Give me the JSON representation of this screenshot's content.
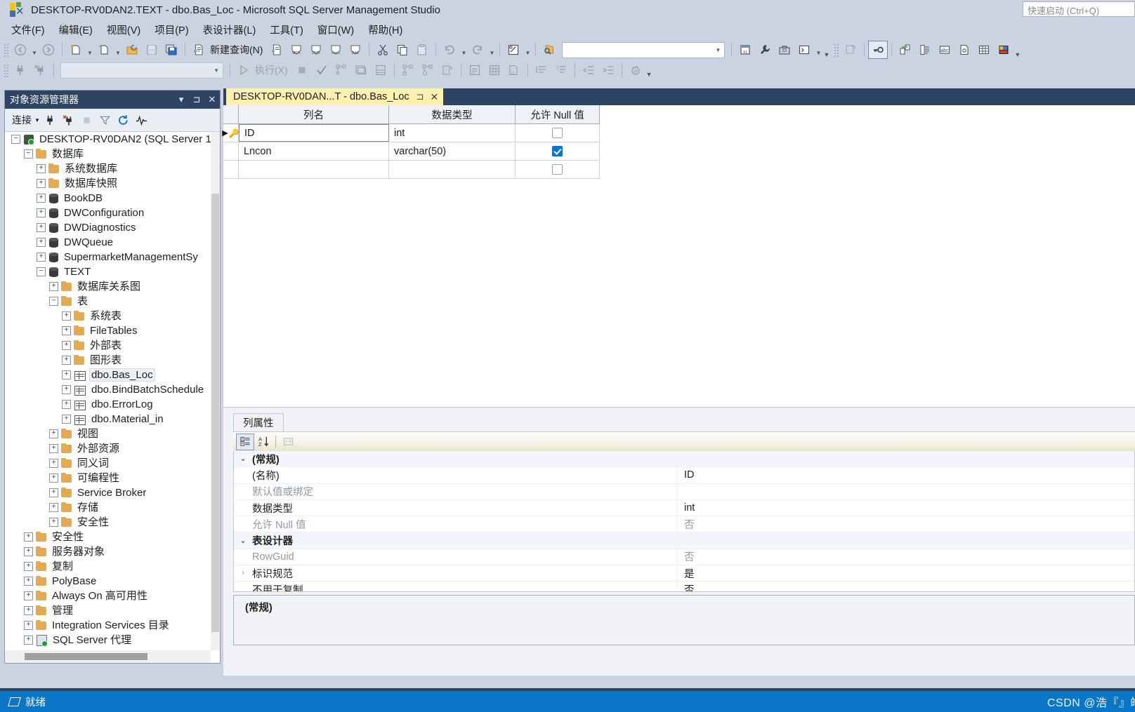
{
  "window": {
    "title": "DESKTOP-RV0DAN2.TEXT - dbo.Bas_Loc - Microsoft SQL Server Management Studio",
    "quick_launch": "快速启动 (Ctrl+Q)"
  },
  "menubar": [
    {
      "label": "文件(F)"
    },
    {
      "label": "编辑(E)"
    },
    {
      "label": "视图(V)"
    },
    {
      "label": "项目(P)"
    },
    {
      "label": "表设计器(L)"
    },
    {
      "label": "工具(T)"
    },
    {
      "label": "窗口(W)"
    },
    {
      "label": "帮助(H)"
    }
  ],
  "toolbar": {
    "new_query_label": "新建查询(N)",
    "execute_label": "执行(X)",
    "db_combo_value": "",
    "filter_combo_value": ""
  },
  "object_explorer": {
    "title": "对象资源管理器",
    "connect_label": "连接",
    "tree": [
      {
        "label": "DESKTOP-RV0DAN2 (SQL Server 1",
        "depth": 0,
        "icon": "server-icon",
        "state": "expanded"
      },
      {
        "label": "数据库",
        "depth": 1,
        "icon": "folder-icon",
        "state": "expanded"
      },
      {
        "label": "系统数据库",
        "depth": 2,
        "icon": "folder-icon",
        "state": "collapsed"
      },
      {
        "label": "数据库快照",
        "depth": 2,
        "icon": "folder-icon",
        "state": "collapsed"
      },
      {
        "label": "BookDB",
        "depth": 2,
        "icon": "database-icon",
        "state": "collapsed"
      },
      {
        "label": "DWConfiguration",
        "depth": 2,
        "icon": "database-icon",
        "state": "collapsed"
      },
      {
        "label": "DWDiagnostics",
        "depth": 2,
        "icon": "database-icon",
        "state": "collapsed"
      },
      {
        "label": "DWQueue",
        "depth": 2,
        "icon": "database-icon",
        "state": "collapsed"
      },
      {
        "label": "SupermarketManagementSy",
        "depth": 2,
        "icon": "database-icon",
        "state": "collapsed"
      },
      {
        "label": "TEXT",
        "depth": 2,
        "icon": "database-icon",
        "state": "expanded"
      },
      {
        "label": "数据库关系图",
        "depth": 3,
        "icon": "folder-icon",
        "state": "collapsed"
      },
      {
        "label": "表",
        "depth": 3,
        "icon": "folder-icon",
        "state": "expanded"
      },
      {
        "label": "系统表",
        "depth": 4,
        "icon": "folder-icon",
        "state": "collapsed"
      },
      {
        "label": "FileTables",
        "depth": 4,
        "icon": "folder-icon",
        "state": "collapsed"
      },
      {
        "label": "外部表",
        "depth": 4,
        "icon": "folder-icon",
        "state": "collapsed"
      },
      {
        "label": "图形表",
        "depth": 4,
        "icon": "folder-icon",
        "state": "collapsed"
      },
      {
        "label": "dbo.Bas_Loc",
        "depth": 4,
        "icon": "table-icon",
        "state": "collapsed",
        "selected": true
      },
      {
        "label": "dbo.BindBatchSchedule",
        "depth": 4,
        "icon": "table-icon",
        "state": "collapsed"
      },
      {
        "label": "dbo.ErrorLog",
        "depth": 4,
        "icon": "table-icon",
        "state": "collapsed"
      },
      {
        "label": "dbo.Material_in",
        "depth": 4,
        "icon": "table-icon",
        "state": "collapsed"
      },
      {
        "label": "视图",
        "depth": 3,
        "icon": "folder-icon",
        "state": "collapsed"
      },
      {
        "label": "外部资源",
        "depth": 3,
        "icon": "folder-icon",
        "state": "collapsed"
      },
      {
        "label": "同义词",
        "depth": 3,
        "icon": "folder-icon",
        "state": "collapsed"
      },
      {
        "label": "可编程性",
        "depth": 3,
        "icon": "folder-icon",
        "state": "collapsed"
      },
      {
        "label": "Service Broker",
        "depth": 3,
        "icon": "folder-icon",
        "state": "collapsed"
      },
      {
        "label": "存储",
        "depth": 3,
        "icon": "folder-icon",
        "state": "collapsed"
      },
      {
        "label": "安全性",
        "depth": 3,
        "icon": "folder-icon",
        "state": "collapsed"
      },
      {
        "label": "安全性",
        "depth": 1,
        "icon": "folder-icon",
        "state": "collapsed"
      },
      {
        "label": "服务器对象",
        "depth": 1,
        "icon": "folder-icon",
        "state": "collapsed"
      },
      {
        "label": "复制",
        "depth": 1,
        "icon": "folder-icon",
        "state": "collapsed"
      },
      {
        "label": "PolyBase",
        "depth": 1,
        "icon": "folder-icon",
        "state": "collapsed"
      },
      {
        "label": "Always On 高可用性",
        "depth": 1,
        "icon": "folder-icon",
        "state": "collapsed"
      },
      {
        "label": "管理",
        "depth": 1,
        "icon": "folder-icon",
        "state": "collapsed"
      },
      {
        "label": "Integration Services 目录",
        "depth": 1,
        "icon": "folder-icon",
        "state": "collapsed"
      },
      {
        "label": "SQL Server 代理",
        "depth": 1,
        "icon": "agent-icon",
        "state": "collapsed"
      }
    ]
  },
  "document": {
    "tab_label": "DESKTOP-RV0DAN...T - dbo.Bas_Loc",
    "designer": {
      "columns": [
        "列名",
        "数据类型",
        "允许 Null 值"
      ],
      "rows": [
        {
          "primary_key": true,
          "name": "ID",
          "type": "int",
          "allow_null": false,
          "active": true
        },
        {
          "primary_key": false,
          "name": "Lncon",
          "type": "varchar(50)",
          "allow_null": true,
          "active": false
        },
        {
          "primary_key": false,
          "name": "",
          "type": "",
          "allow_null": false,
          "active": false
        }
      ]
    }
  },
  "column_properties": {
    "tab_label": "列属性",
    "rows": [
      {
        "kind": "category",
        "name": "(常规)",
        "value": "",
        "expanded": true
      },
      {
        "kind": "prop",
        "name": "(名称)",
        "value": "ID",
        "dim_name": false,
        "dim_value": false
      },
      {
        "kind": "prop",
        "name": "默认值或绑定",
        "value": "",
        "dim_name": true,
        "dim_value": false
      },
      {
        "kind": "prop",
        "name": "数据类型",
        "value": "int",
        "dim_name": false,
        "dim_value": false
      },
      {
        "kind": "prop",
        "name": "允许 Null 值",
        "value": "否",
        "dim_name": true,
        "dim_value": true
      },
      {
        "kind": "category",
        "name": "表设计器",
        "value": "",
        "expanded": true
      },
      {
        "kind": "prop",
        "name": "RowGuid",
        "value": "否",
        "dim_name": true,
        "dim_value": true
      },
      {
        "kind": "prop",
        "name": "标识规范",
        "value": "是",
        "dim_name": false,
        "dim_value": false,
        "expandable": true
      },
      {
        "kind": "prop",
        "name": "不用于复制",
        "value": "否",
        "dim_name": false,
        "dim_value": false
      }
    ],
    "description_title": "(常规)"
  },
  "statusbar": {
    "ready": "就绪",
    "watermark": "CSDN @浩『』皓"
  }
}
